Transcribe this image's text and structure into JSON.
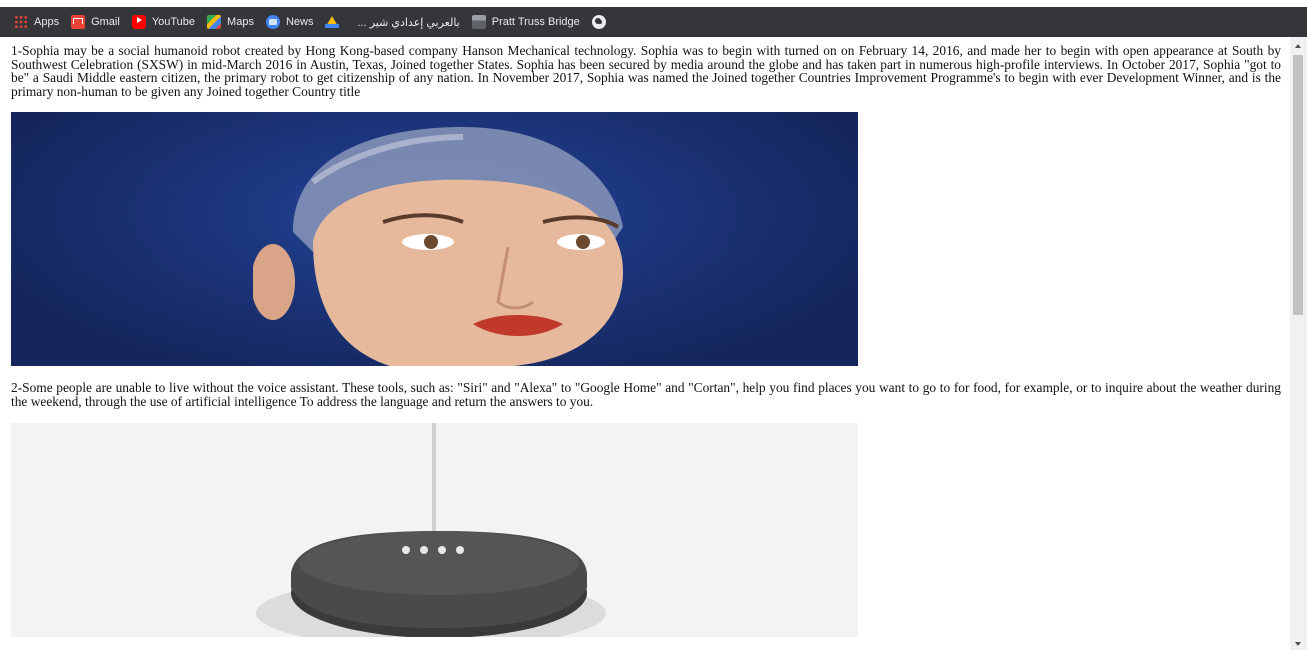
{
  "bookmarks": [
    {
      "label": "Apps",
      "icon": "apps-grid-icon"
    },
    {
      "label": "Gmail",
      "icon": "gmail-icon"
    },
    {
      "label": "YouTube",
      "icon": "youtube-icon"
    },
    {
      "label": "Maps",
      "icon": "maps-icon"
    },
    {
      "label": "News",
      "icon": "news-icon"
    },
    {
      "label": "",
      "icon": "google-drive-icon"
    },
    {
      "label": "بالعربي إعدادي شير ...",
      "icon": "bookmark-site-icon"
    },
    {
      "label": "Pratt Truss Bridge",
      "icon": "pratt-truss-icon"
    },
    {
      "label": "",
      "icon": "globe-icon"
    }
  ],
  "content": {
    "paragraph1": "1-Sophia may be a social humanoid robot created by Hong Kong-based company Hanson Mechanical technology. Sophia was to begin with turned on on February 14, 2016, and made her to begin with open appearance at South by Southwest Celebration (SXSW) in mid-March 2016 in Austin, Texas, Joined together States. Sophia has been secured by media around the globe and has taken part in numerous high-profile interviews. In October 2017, Sophia \"got to be\" a Saudi Middle eastern citizen, the primary robot to get citizenship of any nation. In November 2017, Sophia was named the Joined together Countries Improvement Programme's to begin with ever Development Winner, and is the primary non-human to be given any Joined together Country title",
    "paragraph2": "2-Some people are unable to live without the voice assistant. These tools, such as: \"Siri\" and \"Alexa\" to \"Google Home\" and \"Cortan\", help you find places you want to go to for food, for example, or to inquire about the weather during the weekend, through the use of artificial intelligence To address the language and return the answers to you."
  },
  "colors": {
    "bookmark_bar_bg": "#35363a",
    "bookmark_text": "#e8eaed",
    "sophia_background": "#1d3780"
  }
}
